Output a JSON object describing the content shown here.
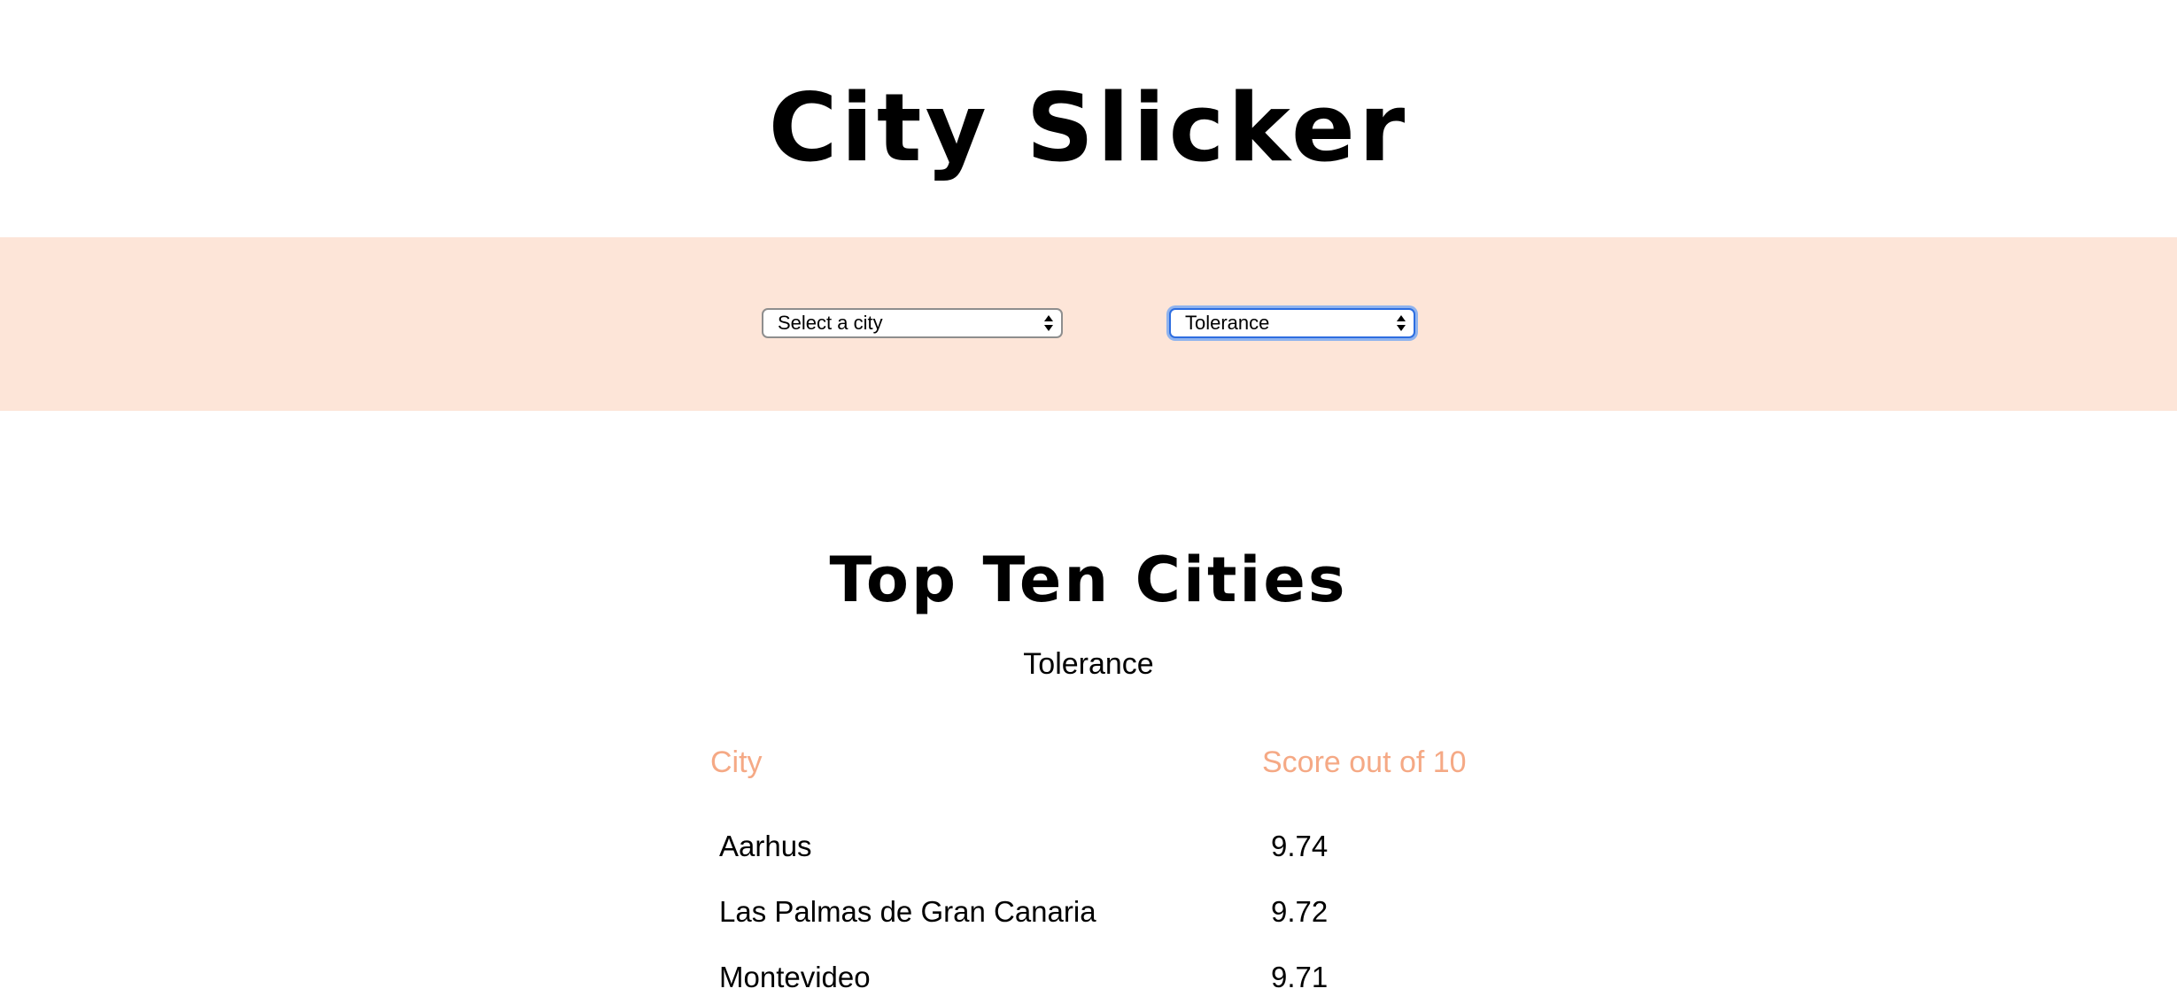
{
  "header": {
    "title": "City Slicker"
  },
  "filters": {
    "city_select": {
      "selected": "Select a city"
    },
    "category_select": {
      "selected": "Tolerance"
    }
  },
  "results": {
    "title": "Top Ten Cities",
    "category": "Tolerance",
    "columns": [
      "City",
      "Score out of 10"
    ],
    "rows": [
      {
        "city": "Aarhus",
        "score": "9.74"
      },
      {
        "city": "Las Palmas de Gran Canaria",
        "score": "9.72"
      },
      {
        "city": "Montevideo",
        "score": "9.71"
      }
    ]
  },
  "colors": {
    "band": "#fde5d8",
    "header_text": "#f5a985",
    "focus_ring": "#2d6de0"
  }
}
